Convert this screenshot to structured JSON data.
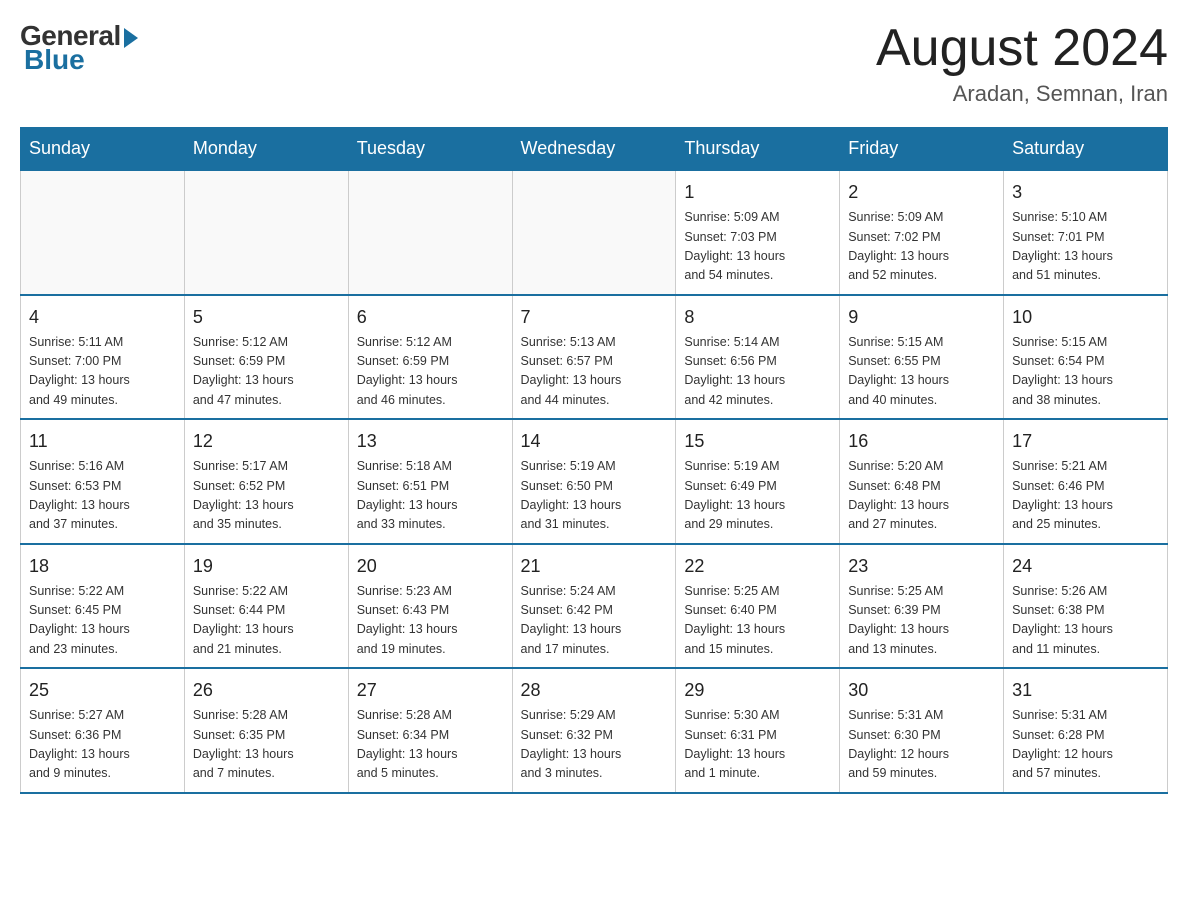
{
  "header": {
    "logo_general": "General",
    "logo_blue": "Blue",
    "month_title": "August 2024",
    "subtitle": "Aradan, Semnan, Iran"
  },
  "weekdays": [
    "Sunday",
    "Monday",
    "Tuesday",
    "Wednesday",
    "Thursday",
    "Friday",
    "Saturday"
  ],
  "weeks": [
    [
      {
        "day": "",
        "info": ""
      },
      {
        "day": "",
        "info": ""
      },
      {
        "day": "",
        "info": ""
      },
      {
        "day": "",
        "info": ""
      },
      {
        "day": "1",
        "info": "Sunrise: 5:09 AM\nSunset: 7:03 PM\nDaylight: 13 hours\nand 54 minutes."
      },
      {
        "day": "2",
        "info": "Sunrise: 5:09 AM\nSunset: 7:02 PM\nDaylight: 13 hours\nand 52 minutes."
      },
      {
        "day": "3",
        "info": "Sunrise: 5:10 AM\nSunset: 7:01 PM\nDaylight: 13 hours\nand 51 minutes."
      }
    ],
    [
      {
        "day": "4",
        "info": "Sunrise: 5:11 AM\nSunset: 7:00 PM\nDaylight: 13 hours\nand 49 minutes."
      },
      {
        "day": "5",
        "info": "Sunrise: 5:12 AM\nSunset: 6:59 PM\nDaylight: 13 hours\nand 47 minutes."
      },
      {
        "day": "6",
        "info": "Sunrise: 5:12 AM\nSunset: 6:59 PM\nDaylight: 13 hours\nand 46 minutes."
      },
      {
        "day": "7",
        "info": "Sunrise: 5:13 AM\nSunset: 6:57 PM\nDaylight: 13 hours\nand 44 minutes."
      },
      {
        "day": "8",
        "info": "Sunrise: 5:14 AM\nSunset: 6:56 PM\nDaylight: 13 hours\nand 42 minutes."
      },
      {
        "day": "9",
        "info": "Sunrise: 5:15 AM\nSunset: 6:55 PM\nDaylight: 13 hours\nand 40 minutes."
      },
      {
        "day": "10",
        "info": "Sunrise: 5:15 AM\nSunset: 6:54 PM\nDaylight: 13 hours\nand 38 minutes."
      }
    ],
    [
      {
        "day": "11",
        "info": "Sunrise: 5:16 AM\nSunset: 6:53 PM\nDaylight: 13 hours\nand 37 minutes."
      },
      {
        "day": "12",
        "info": "Sunrise: 5:17 AM\nSunset: 6:52 PM\nDaylight: 13 hours\nand 35 minutes."
      },
      {
        "day": "13",
        "info": "Sunrise: 5:18 AM\nSunset: 6:51 PM\nDaylight: 13 hours\nand 33 minutes."
      },
      {
        "day": "14",
        "info": "Sunrise: 5:19 AM\nSunset: 6:50 PM\nDaylight: 13 hours\nand 31 minutes."
      },
      {
        "day": "15",
        "info": "Sunrise: 5:19 AM\nSunset: 6:49 PM\nDaylight: 13 hours\nand 29 minutes."
      },
      {
        "day": "16",
        "info": "Sunrise: 5:20 AM\nSunset: 6:48 PM\nDaylight: 13 hours\nand 27 minutes."
      },
      {
        "day": "17",
        "info": "Sunrise: 5:21 AM\nSunset: 6:46 PM\nDaylight: 13 hours\nand 25 minutes."
      }
    ],
    [
      {
        "day": "18",
        "info": "Sunrise: 5:22 AM\nSunset: 6:45 PM\nDaylight: 13 hours\nand 23 minutes."
      },
      {
        "day": "19",
        "info": "Sunrise: 5:22 AM\nSunset: 6:44 PM\nDaylight: 13 hours\nand 21 minutes."
      },
      {
        "day": "20",
        "info": "Sunrise: 5:23 AM\nSunset: 6:43 PM\nDaylight: 13 hours\nand 19 minutes."
      },
      {
        "day": "21",
        "info": "Sunrise: 5:24 AM\nSunset: 6:42 PM\nDaylight: 13 hours\nand 17 minutes."
      },
      {
        "day": "22",
        "info": "Sunrise: 5:25 AM\nSunset: 6:40 PM\nDaylight: 13 hours\nand 15 minutes."
      },
      {
        "day": "23",
        "info": "Sunrise: 5:25 AM\nSunset: 6:39 PM\nDaylight: 13 hours\nand 13 minutes."
      },
      {
        "day": "24",
        "info": "Sunrise: 5:26 AM\nSunset: 6:38 PM\nDaylight: 13 hours\nand 11 minutes."
      }
    ],
    [
      {
        "day": "25",
        "info": "Sunrise: 5:27 AM\nSunset: 6:36 PM\nDaylight: 13 hours\nand 9 minutes."
      },
      {
        "day": "26",
        "info": "Sunrise: 5:28 AM\nSunset: 6:35 PM\nDaylight: 13 hours\nand 7 minutes."
      },
      {
        "day": "27",
        "info": "Sunrise: 5:28 AM\nSunset: 6:34 PM\nDaylight: 13 hours\nand 5 minutes."
      },
      {
        "day": "28",
        "info": "Sunrise: 5:29 AM\nSunset: 6:32 PM\nDaylight: 13 hours\nand 3 minutes."
      },
      {
        "day": "29",
        "info": "Sunrise: 5:30 AM\nSunset: 6:31 PM\nDaylight: 13 hours\nand 1 minute."
      },
      {
        "day": "30",
        "info": "Sunrise: 5:31 AM\nSunset: 6:30 PM\nDaylight: 12 hours\nand 59 minutes."
      },
      {
        "day": "31",
        "info": "Sunrise: 5:31 AM\nSunset: 6:28 PM\nDaylight: 12 hours\nand 57 minutes."
      }
    ]
  ]
}
